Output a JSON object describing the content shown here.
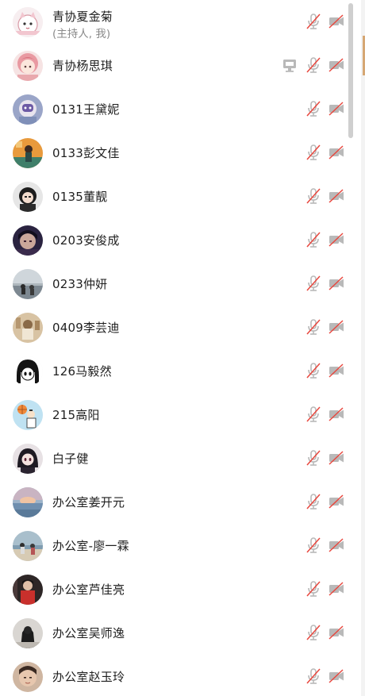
{
  "participants": [
    {
      "name": "青协夏金菊",
      "subtitle": "(主持人, 我)",
      "avatar": "cartoon-cat",
      "mic": "muted",
      "camera": "off",
      "sharing": false
    },
    {
      "name": "青协杨思琪",
      "subtitle": "",
      "avatar": "pink-hair-girl",
      "mic": "muted",
      "camera": "off",
      "sharing": true
    },
    {
      "name": "0131王黛妮",
      "subtitle": "",
      "avatar": "toy-character",
      "mic": "muted",
      "camera": "off",
      "sharing": false
    },
    {
      "name": "0133彭文佳",
      "subtitle": "",
      "avatar": "orange-photo",
      "mic": "muted",
      "camera": "off",
      "sharing": false
    },
    {
      "name": "0135董靓",
      "subtitle": "",
      "avatar": "girl-black-hair",
      "mic": "muted",
      "camera": "off",
      "sharing": false
    },
    {
      "name": "0203安俊成",
      "subtitle": "",
      "avatar": "dark-anime",
      "mic": "muted",
      "camera": "off",
      "sharing": false
    },
    {
      "name": "0233仲妍",
      "subtitle": "",
      "avatar": "seaside-photo",
      "mic": "muted",
      "camera": "off",
      "sharing": false
    },
    {
      "name": "0409李芸迪",
      "subtitle": "",
      "avatar": "sepia-photo",
      "mic": "muted",
      "camera": "off",
      "sharing": false
    },
    {
      "name": "126马毅然",
      "subtitle": "",
      "avatar": "manga-girl",
      "mic": "muted",
      "camera": "off",
      "sharing": false
    },
    {
      "name": "215高阳",
      "subtitle": "",
      "avatar": "basketball-cartoon",
      "mic": "muted",
      "camera": "off",
      "sharing": false
    },
    {
      "name": "白子健",
      "subtitle": "",
      "avatar": "anime-dark-hair",
      "mic": "muted",
      "camera": "off",
      "sharing": false
    },
    {
      "name": "办公室姜开元",
      "subtitle": "",
      "avatar": "sunset-sea",
      "mic": "muted",
      "camera": "off",
      "sharing": false
    },
    {
      "name": "办公室-廖一霖",
      "subtitle": "",
      "avatar": "beach-photo",
      "mic": "muted",
      "camera": "off",
      "sharing": false
    },
    {
      "name": "办公室芦佳亮",
      "subtitle": "",
      "avatar": "red-outfit-photo",
      "mic": "muted",
      "camera": "off",
      "sharing": false
    },
    {
      "name": "办公室吴师逸",
      "subtitle": "",
      "avatar": "dark-figure-photo",
      "mic": "muted",
      "camera": "off",
      "sharing": false
    },
    {
      "name": "办公室赵玉玲",
      "subtitle": "",
      "avatar": "face-photo",
      "mic": "muted",
      "camera": "off",
      "sharing": false
    }
  ],
  "colors": {
    "muted_slash": "#e8473e",
    "icon_gray": "#b9b9b9",
    "name_text": "#1f1f1f",
    "subtitle_text": "#8a8a8a"
  }
}
